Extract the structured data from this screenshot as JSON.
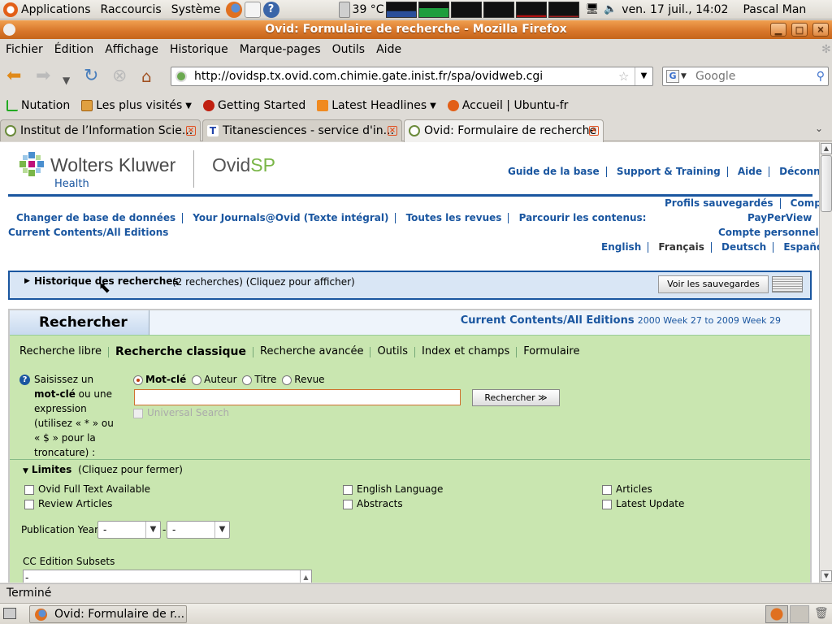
{
  "panel": {
    "menus": [
      "Applications",
      "Raccourcis",
      "Système"
    ],
    "temperature": "39 °C",
    "datetime": "ven. 17 juil., 14:02",
    "user": "Pascal Man"
  },
  "window": {
    "title": "Ovid: Formulaire de recherche - Mozilla Firefox"
  },
  "menubar": [
    "Fichier",
    "Édition",
    "Affichage",
    "Historique",
    "Marque-pages",
    "Outils",
    "Aide"
  ],
  "nav": {
    "url": "http://ovidsp.tx.ovid.com.chimie.gate.inist.fr/spa/ovidweb.cgi",
    "search_placeholder": "Google"
  },
  "bookmarks": [
    "Nutation",
    "Les plus visités",
    "Getting Started",
    "Latest Headlines",
    "Accueil | Ubuntu-fr"
  ],
  "tabs": [
    {
      "label": "Institut de l’Information Scie..."
    },
    {
      "label": "Titanesciences - service d'in..."
    },
    {
      "label": "Ovid: Formulaire de recherche"
    }
  ],
  "page": {
    "brand": {
      "company": "Wolters Kluwer",
      "division": "Health",
      "product_a": "Ovid",
      "product_b": "SP"
    },
    "toplinks": [
      "Guide de la base",
      "Support & Training",
      "Aide",
      "Déconnexion"
    ],
    "rightlinks": [
      "Profils sauvegardés",
      "Compte",
      "PayPerView",
      "Compte personnel"
    ],
    "navlinks": [
      "Changer de base de données",
      "Your Journals@Ovid (Texte intégral)",
      "Toutes les revues",
      "Parcourir les contenus:",
      "Current Contents/All Editions"
    ],
    "languages": [
      "English",
      "Français",
      "Deutsch",
      "Español"
    ],
    "history": {
      "title": "Historique des recherches",
      "detail": "(2 recherches) (Cliquez pour afficher)",
      "saved_button": "Voir les sauvegardes"
    },
    "search": {
      "heading": "Rechercher",
      "db_name": "Current Contents/All Editions",
      "db_range": "2000 Week 27 to 2009 Week 29",
      "tabs": [
        "Recherche libre",
        "Recherche classique",
        "Recherche avancée",
        "Outils",
        "Index et champs",
        "Formulaire"
      ],
      "help_lines": [
        "Saisissez un",
        "mot-clé",
        "ou une",
        "expression",
        "(utilisez « * » ou",
        "« $ » pour la",
        "troncature) :"
      ],
      "radios": [
        "Mot-clé",
        "Auteur",
        "Titre",
        "Revue"
      ],
      "input_value": "",
      "button": "Rechercher ≫",
      "universal": "Universal Search"
    },
    "limits": {
      "title": "Limites",
      "detail": "(Cliquez pour fermer)",
      "col1": [
        "Ovid Full Text Available",
        "Review Articles"
      ],
      "col2": [
        "English Language",
        "Abstracts"
      ],
      "col3": [
        "Articles",
        "Latest Update"
      ],
      "pub_year_label": "Publication Year",
      "pub_from": "-",
      "pub_dash": "-",
      "pub_to": "-",
      "cc_label": "CC Edition Subsets",
      "cc_value": "-"
    }
  },
  "status": "Terminé",
  "taskbar": {
    "window_label": "Ovid: Formulaire de r..."
  },
  "colors": {
    "ovid_blue": "#1a56a0",
    "search_green": "#c9e6b0",
    "firefox_orange": "#d9782c"
  }
}
